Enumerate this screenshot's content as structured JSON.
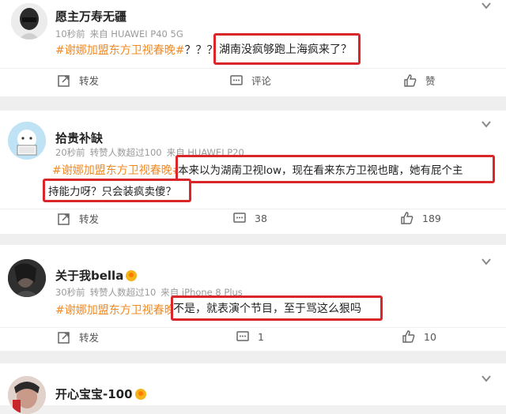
{
  "posts": [
    {
      "name": "愿主万寿无疆",
      "meta": {
        "time": "10秒前",
        "source": "来自 HUAWEI P40 5G"
      },
      "hashtag": "#谢娜加盟东方卫视春晚#",
      "text_pre": "？？？",
      "highlight": "湖南没疯够跑上海疯来了？",
      "actions": {
        "repost": "转发",
        "comment": "评论",
        "like": "赞"
      }
    },
    {
      "name": "拾贵补缺",
      "meta": {
        "time": "20秒前",
        "reposts": "转赞人数超过100",
        "source": "来自 HUAWEI P20"
      },
      "hashtag": "#谢娜加盟东方卫视春晚#",
      "highlight_line1": "本来以为湖南卫视low，现在看来东方卫视也瞎，她有屁个主",
      "highlight_line2": "持能力呀？只会装疯卖傻？",
      "actions": {
        "repost": "转发",
        "comment": "38",
        "like": "189"
      }
    },
    {
      "name": "关于我bella",
      "meta": {
        "time": "30秒前",
        "reposts": "转赞人数超过10",
        "source": "来自 iPhone 8 Plus"
      },
      "hashtag": "#谢娜加盟东方卫视春晚#",
      "highlight": "不是，就表演个节目，至于骂这么狠吗",
      "actions": {
        "repost": "转发",
        "comment": "1",
        "like": "10"
      }
    },
    {
      "name": "开心宝宝-100"
    }
  ],
  "icons": {
    "repost": "share-icon",
    "comment": "comment-icon",
    "like": "thumbs-up-icon",
    "menu": "chevron-down-icon"
  },
  "colors": {
    "highlight_border": "#d8262b",
    "hashtag": "#f08a24",
    "background": "#f1f1f1"
  }
}
